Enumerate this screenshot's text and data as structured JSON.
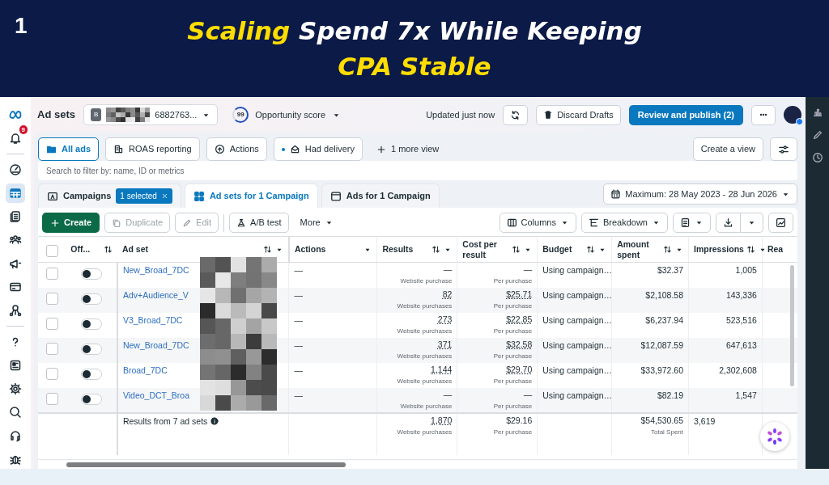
{
  "banner": {
    "number": "1",
    "title_lines": [
      [
        {
          "text": "Scaling",
          "highlight": true
        },
        {
          "text": " Spend 7x While Keeping",
          "highlight": false
        }
      ],
      [
        {
          "text": "CPA Stable",
          "highlight": true
        }
      ]
    ]
  },
  "rail": {
    "notification_count": "9",
    "items": [
      {
        "selected": false
      },
      {
        "selected": true
      },
      {
        "selected": false
      },
      {
        "selected": false
      },
      {
        "selected": false
      },
      {
        "selected": false
      },
      {
        "selected": false
      }
    ]
  },
  "header": {
    "title": "Ad sets",
    "account": {
      "badge": "B",
      "name": "6882763..."
    },
    "opportunity": {
      "score": "99",
      "label": "Opportunity score"
    },
    "updated": "Updated just now",
    "discard": "Discard Drafts",
    "publish": "Review and publish (2)"
  },
  "views": {
    "tabs": [
      {
        "label": "All ads",
        "selected": true
      },
      {
        "label": "ROAS reporting",
        "selected": false
      },
      {
        "label": "Actions",
        "selected": false
      },
      {
        "label": "Had delivery",
        "selected": false
      }
    ],
    "more": "1 more view",
    "create": "Create a view"
  },
  "search": {
    "placeholder": "Search to filter by: name, ID or metrics"
  },
  "levels": {
    "tabs": [
      {
        "label": "Campaigns",
        "selected": false,
        "badge": "1 selected"
      },
      {
        "label": "Ad sets for 1 Campaign",
        "selected": true
      },
      {
        "label": "Ads for 1 Campaign",
        "selected": false
      }
    ],
    "date": "Maximum: 28 May 2023 - 28 Jun 2026"
  },
  "toolbar": {
    "left": [
      {
        "label": "Create",
        "kind": "primary",
        "disabled": false
      },
      {
        "label": "Duplicate",
        "kind": "outline",
        "disabled": true
      },
      {
        "label": "Edit",
        "kind": "outline",
        "disabled": true
      },
      {
        "label": "A/B test",
        "kind": "outline",
        "disabled": false
      },
      {
        "label": "More",
        "kind": "menu",
        "disabled": false
      }
    ],
    "right": [
      {
        "label": "Columns"
      },
      {
        "label": "Breakdown"
      }
    ]
  },
  "table": {
    "all_checked": false,
    "columns": [
      {
        "label": "Off...",
        "sortable": true,
        "menu": false
      },
      {
        "label": "Ad set",
        "sortable": true,
        "menu": true
      },
      {
        "label": "Actions",
        "sortable": false,
        "menu": true
      },
      {
        "label": "Results",
        "sortable": true,
        "menu": true
      },
      {
        "label": "Cost per result",
        "sortable": true,
        "menu": true
      },
      {
        "label": "Budget",
        "sortable": true,
        "menu": true
      },
      {
        "label": "Amount spent",
        "sortable": true,
        "menu": true
      },
      {
        "label": "Impressions",
        "sortable": true,
        "menu": true
      },
      {
        "label": "Rea",
        "sortable": false,
        "menu": false
      }
    ],
    "rows": [
      {
        "checked": false,
        "on": false,
        "name": "New_Broad_7DC",
        "actions": "—",
        "results": {
          "value": "—",
          "unit": "Website purchase",
          "linked": false
        },
        "cost": {
          "value": "—",
          "unit": "Per purchase",
          "linked": false
        },
        "budget": "Using campaign…",
        "amount": "$32.37",
        "impressions": "1,005"
      },
      {
        "checked": false,
        "on": false,
        "name": "Adv+Audience_V",
        "actions": "—",
        "results": {
          "value": "82",
          "unit": "Website purchases",
          "linked": true
        },
        "cost": {
          "value": "$25.71",
          "unit": "Per purchase",
          "linked": true
        },
        "budget": "Using campaign…",
        "amount": "$2,108.58",
        "impressions": "143,336"
      },
      {
        "checked": false,
        "on": false,
        "name": "V3_Broad_7DC",
        "actions": "—",
        "results": {
          "value": "273",
          "unit": "Website purchases",
          "linked": true
        },
        "cost": {
          "value": "$22.85",
          "unit": "Per purchase",
          "linked": true
        },
        "budget": "Using campaign…",
        "amount": "$6,237.94",
        "impressions": "523,516"
      },
      {
        "checked": false,
        "on": false,
        "name": "New_Broad_7DC",
        "actions": "—",
        "results": {
          "value": "371",
          "unit": "Website purchases",
          "linked": true
        },
        "cost": {
          "value": "$32.58",
          "unit": "Per purchase",
          "linked": true
        },
        "budget": "Using campaign…",
        "amount": "$12,087.59",
        "impressions": "647,613"
      },
      {
        "checked": false,
        "on": false,
        "name": "Broad_7DC",
        "actions": "—",
        "results": {
          "value": "1,144",
          "unit": "Website purchases",
          "linked": true
        },
        "cost": {
          "value": "$29.70",
          "unit": "Per purchase",
          "linked": true
        },
        "budget": "Using campaign…",
        "amount": "$33,972.60",
        "impressions": "2,302,608"
      },
      {
        "checked": false,
        "on": false,
        "name": "Video_DCT_Broa",
        "actions": "—",
        "results": {
          "value": "—",
          "unit": "Website purchase",
          "linked": false
        },
        "cost": {
          "value": "—",
          "unit": "Per purchase",
          "linked": false
        },
        "budget": "Using campaign…",
        "amount": "$82.19",
        "impressions": "1,547"
      }
    ],
    "summary": {
      "label": "Results from 7 ad sets",
      "results": {
        "value": "1,870",
        "unit": "Website purchases",
        "linked": true
      },
      "cost": {
        "value": "$29.16",
        "unit": "Per purchase",
        "linked": false
      },
      "amount": {
        "value": "$54,530.65",
        "unit": "Total Spent"
      },
      "impressions": "3,619"
    }
  }
}
